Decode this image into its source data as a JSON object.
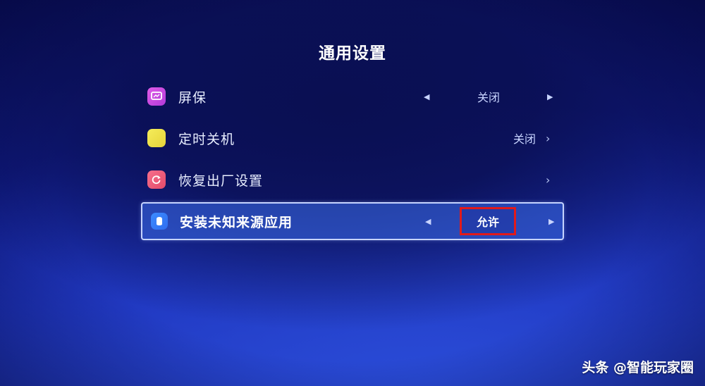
{
  "header": {
    "title": "通用设置"
  },
  "menu": {
    "items": [
      {
        "label": "屏保",
        "value": "关闭",
        "icon": "screensaver-icon",
        "left_arrow": "◀",
        "right_arrow": "▶"
      },
      {
        "label": "定时关机",
        "value": "关闭",
        "icon": "timer-icon",
        "chevron": "›"
      },
      {
        "label": "恢复出厂设置",
        "icon": "reset-icon",
        "chevron": "›"
      },
      {
        "label": "安装未知来源应用",
        "value": "允许",
        "icon": "install-icon",
        "left_arrow": "◀",
        "right_arrow": "▶",
        "selected": true
      }
    ]
  },
  "watermark": {
    "text": "头条 @智能玩家圈"
  },
  "colors": {
    "highlight_border": "#e21a1a",
    "selected_background": "#3c6eeb",
    "screensaver_icon": "#c946e0",
    "timer_icon": "#f0e24a",
    "reset_icon": "#ee5a7a",
    "install_icon": "#3479f8"
  }
}
